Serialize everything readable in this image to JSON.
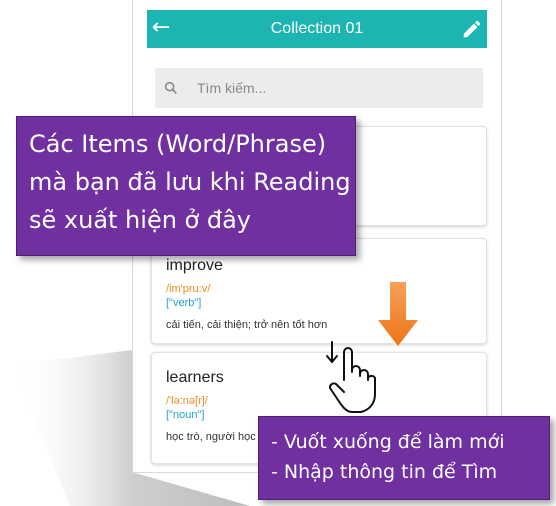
{
  "appbar": {
    "title": "Collection 01",
    "background": "#1cb5b1",
    "back_icon": "arrow-left-icon",
    "edit_icon": "pencil-icon"
  },
  "search": {
    "placeholder": "Tìm kiếm...",
    "icon": "search-icon"
  },
  "items": [
    {
      "word": "improve",
      "ipa": "/im'pru:v/",
      "pos": "[\"verb\"]",
      "meaning": "cải tiến, cải thiện; trở nên tốt hơn"
    },
    {
      "word": "learners",
      "ipa": "/'lə:nə[r]/",
      "pos": "[\"noun\"]",
      "meaning": "học trò, người học"
    }
  ],
  "callouts": {
    "top": {
      "line1": "Các Items (Word/Phrase)",
      "line2": "mà bạn đã lưu khi Reading",
      "line3": "sẽ xuất hiện ở đây"
    },
    "bottom": {
      "line1": "- Vuốt xuống để làm mới",
      "line2": "- Nhập thông tin để Tìm"
    },
    "background": "#7030a0"
  },
  "colors": {
    "ipa": "#e88b1c",
    "pos": "#1ca3d6",
    "arrow": "#f07c1e"
  }
}
